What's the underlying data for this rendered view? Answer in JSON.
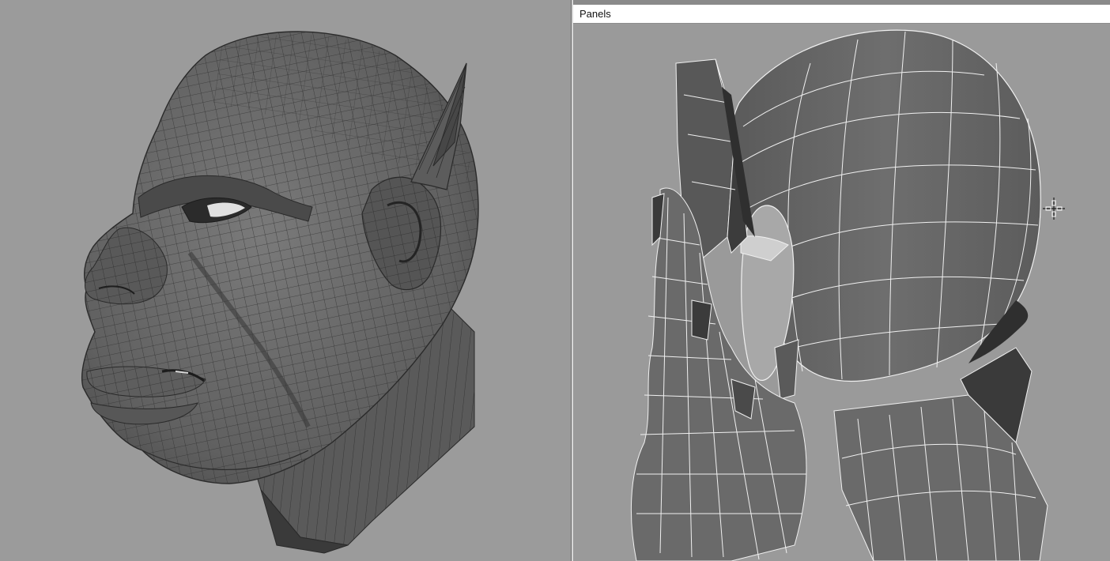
{
  "menubar": {
    "panels_label": "Panels"
  },
  "viewports": {
    "left": {
      "content": "high-resolution-head-mesh-wireframe"
    },
    "right": {
      "content": "low-resolution-head-mesh-wireframe"
    }
  },
  "cursor": {
    "icon": "move-crosshair-icon"
  },
  "colors": {
    "viewport_background": "#9b9b9b",
    "mesh_surface": "#6a6a6a",
    "mesh_dark": "#3c3c3c",
    "wire_dark": "#2a2a2a",
    "wire_light": "#f2f2f2",
    "menubar_background": "#ffffff"
  }
}
